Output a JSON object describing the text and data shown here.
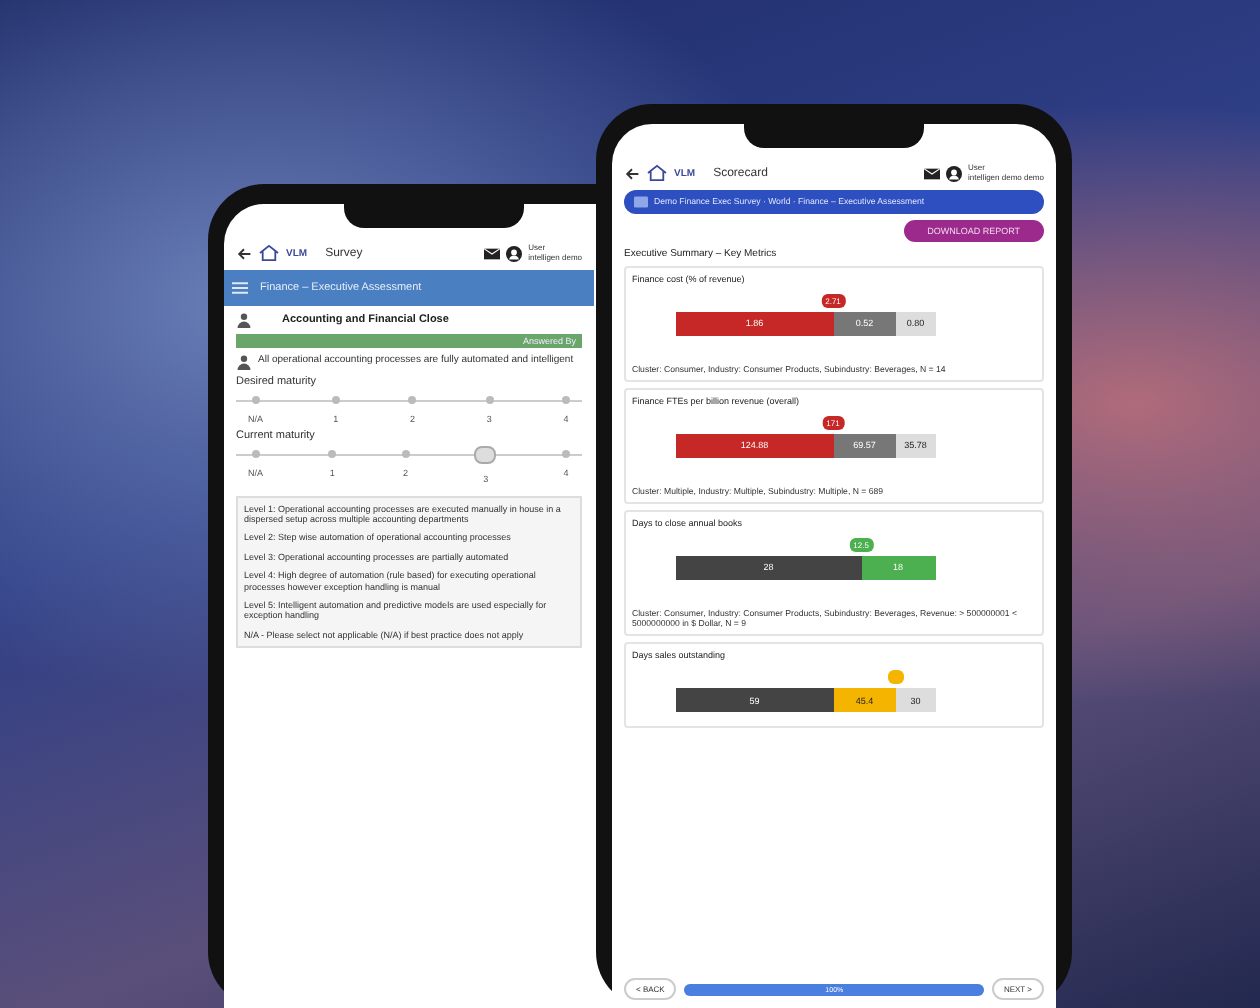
{
  "survey_phone": {
    "header": {
      "logo": "VLM",
      "title": "Survey",
      "user_label": "User",
      "user_name": "intelligen demo"
    },
    "banner": "Finance – Executive Assessment",
    "section": "Accounting and Financial Close",
    "answered_by": "Answered By",
    "question": "All operational accounting processes are fully automated and intelligent",
    "scales": [
      {
        "label": "Desired maturity",
        "options": [
          {
            "label": "N/A",
            "selected": false
          },
          {
            "label": "1",
            "selected": false
          },
          {
            "label": "2",
            "selected": false
          },
          {
            "label": "3",
            "selected": false
          },
          {
            "label": "4",
            "selected": false
          }
        ]
      },
      {
        "label": "Current maturity",
        "options": [
          {
            "label": "N/A",
            "selected": false
          },
          {
            "label": "1",
            "selected": false
          },
          {
            "label": "2",
            "selected": false
          },
          {
            "label": "3",
            "selected": true
          },
          {
            "label": "4",
            "selected": false
          }
        ]
      }
    ],
    "levels": [
      "Level 1: Operational accounting processes are executed manually in house in a dispersed setup across multiple accounting departments",
      "Level 2: Step wise automation of operational accounting processes",
      "Level 3: Operational accounting processes are partially automated",
      "Level 4: High degree of automation (rule based) for executing operational processes however exception handling is manual",
      "Level 5: Intelligent automation and predictive models are used especially for exception handling",
      "N/A - Please select not applicable (N/A) if best practice does not apply"
    ]
  },
  "scorecard_phone": {
    "header": {
      "logo": "VLM",
      "title": "Scorecard",
      "user_label": "User",
      "user_name": "intelligen demo demo"
    },
    "breadcrumb": "Demo Finance Exec Survey · World · Finance – Executive Assessment",
    "download_button": "DOWNLOAD REPORT",
    "summary_title": "Executive Summary – Key Metrics",
    "metrics": [
      {
        "title": "Finance cost (% of revenue)",
        "segments": [
          {
            "value": "1.86",
            "color": "#c62828",
            "marker": {
              "value": "2.71",
              "color": "#c62828"
            }
          },
          {
            "value": "0.52",
            "color": "#777777"
          },
          {
            "value": "0.80",
            "color": "#dddddd"
          }
        ],
        "caption": "Cluster: Consumer, Industry: Consumer Products, Subindustry: Beverages, N = 14"
      },
      {
        "title": "Finance FTEs per billion revenue (overall)",
        "segments": [
          {
            "value": "124.88",
            "color": "#c62828",
            "marker": {
              "value": "171",
              "color": "#c62828"
            }
          },
          {
            "value": "69.57",
            "color": "#777777"
          },
          {
            "value": "35.78",
            "color": "#dddddd"
          }
        ],
        "caption": "Cluster: Multiple, Industry: Multiple, Subindustry: Multiple, N = 689"
      },
      {
        "title": "Days to close annual books",
        "segments": [
          {
            "value": "28",
            "color": "#444444",
            "marker": {
              "value": "12.5",
              "color": "#4caf50"
            }
          },
          {
            "value": "18",
            "color": "#4caf50"
          }
        ],
        "caption": "Cluster: Consumer, Industry: Consumer Products, Subindustry: Beverages, Revenue: > 500000001 < 5000000000 in $ Dollar, N = 9"
      },
      {
        "title": "Days sales outstanding",
        "segments": [
          {
            "value": "59",
            "color": "#444444"
          },
          {
            "value": "45.4",
            "color": "#f4b400",
            "marker": {
              "color": "#f4b400"
            }
          },
          {
            "value": "30",
            "color": "#dddddd"
          }
        ]
      }
    ],
    "nav": {
      "back": "< BACK",
      "next": "NEXT >",
      "progress": {
        "label": "100%",
        "level": 1
      }
    }
  }
}
